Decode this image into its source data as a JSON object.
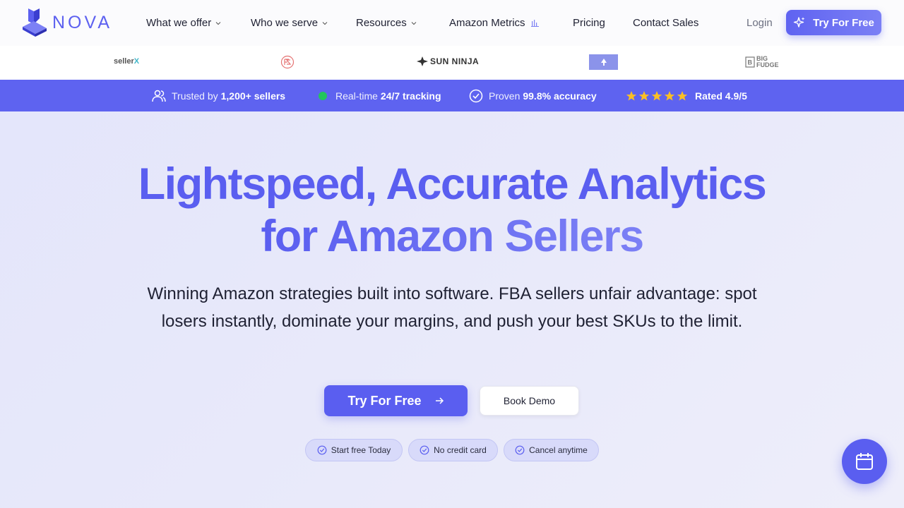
{
  "brand": {
    "name": "NOVA"
  },
  "nav": {
    "items": [
      {
        "label": "What we offer",
        "has_dropdown": true
      },
      {
        "label": "Who we serve",
        "has_dropdown": true
      },
      {
        "label": "Resources",
        "has_dropdown": true
      },
      {
        "label": "Amazon Metrics",
        "icon": "bar-chart-icon"
      },
      {
        "label": "Pricing"
      },
      {
        "label": "Contact Sales"
      }
    ],
    "login": "Login",
    "cta": "Try For Free"
  },
  "partners": {
    "sellerx": {
      "name": "seller",
      "suffix": "X"
    },
    "sunninja": {
      "name": "SUN NINJA"
    },
    "big_fudge_1": "BIG",
    "big_fudge_2": "FUDGE"
  },
  "trust_bar": {
    "trusted_prefix": "Trusted by",
    "trusted_value": "1,200+ sellers",
    "tracking_prefix": "Real-time",
    "tracking_value": "24/7 tracking",
    "accuracy_prefix": "Proven",
    "accuracy_value": "99.8% accuracy",
    "rating_stars": 5,
    "rating": "Rated 4.9/5"
  },
  "hero": {
    "headline_line1": "Lightspeed, Accurate Analytics",
    "headline_line2": "for Amazon Sellers",
    "subheadline": "Winning Amazon strategies built into software. FBA sellers unfair advantage: spot losers instantly, dominate your margins, and push your best SKUs to the limit.",
    "primary_cta": "Try For Free",
    "secondary_cta": "Book Demo",
    "pills": [
      "Start free Today",
      "No credit card",
      "Cancel anytime"
    ]
  },
  "colors": {
    "accent": "#5a5ef0",
    "trust_bar": "#5e63f0",
    "star": "#fbbf24",
    "live_dot": "#22c55e"
  }
}
